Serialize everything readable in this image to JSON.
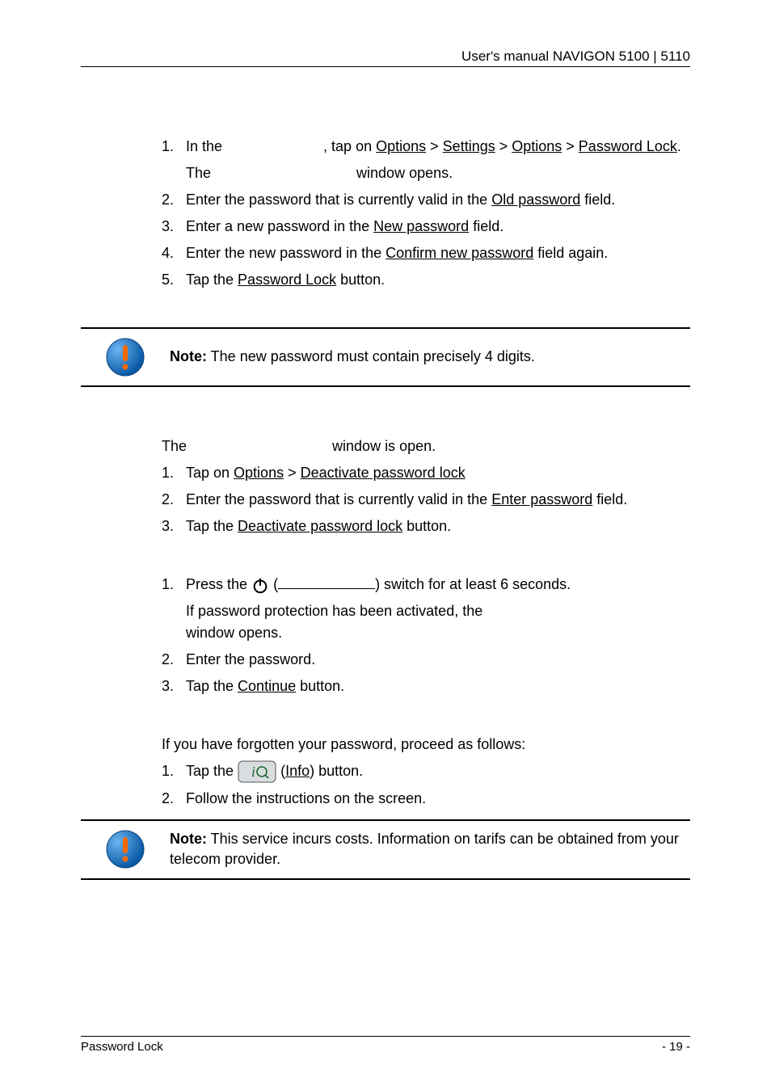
{
  "header": "User's manual NAVIGON 5100 | 5110",
  "s1": {
    "step1a": "In the ",
    "step1b": ", tap on ",
    "u1": "Options",
    "gt": " > ",
    "u2": "Settings",
    "u3": "Options",
    "u4": "Password Lock",
    "period": ".",
    "sub1a": "The ",
    "sub1b": " window opens.",
    "step2a": "Enter the password that is currently valid in the ",
    "u5": "Old password",
    "step2b": " field.",
    "step3a": "Enter a new password in the ",
    "u6": "New password",
    "step3b": " field.",
    "step4a": "Enter the new password in the ",
    "u7": "Confirm new password",
    "step4b": " field again.",
    "step5a": "Tap the ",
    "u8": "Password Lock",
    "step5b": " button."
  },
  "note1": {
    "prefix": "Note:",
    "text": " The new password must contain precisely 4 digits."
  },
  "s2": {
    "introa": "The ",
    "introb": " window is open.",
    "step1a": "Tap on ",
    "u1": "Options",
    "gt": " > ",
    "u2": "Deactivate password lock",
    "step2a": "Enter the password that is currently valid in the ",
    "u3": "Enter password",
    "step2b": " field.",
    "step3a": "Tap the ",
    "u4": "Deactivate password lock",
    "step3b": " button."
  },
  "s3": {
    "step1a": "Press the ",
    "step1b": "(",
    "step1c": ") switch for at least 6 seconds.",
    "sub1a": "If password protection has been activated, the ",
    "sub1b": " window opens.",
    "step2": "Enter the password.",
    "step3a": "Tap the ",
    "u1": "Continue",
    "step3b": " button."
  },
  "s4": {
    "intro": "If you have forgotten your password, proceed as follows:",
    "step1a": "Tap the ",
    "step1b": " (",
    "u1": "Info",
    "step1c": ") button.",
    "step2": "Follow the instructions on the screen."
  },
  "note2": {
    "prefix": "Note:",
    "text": " This service incurs costs. Information on tarifs can be obtained from your telecom provider."
  },
  "footer": {
    "left": "Password Lock",
    "right": "- 19 -"
  },
  "nums": {
    "n1": "1.",
    "n2": "2.",
    "n3": "3.",
    "n4": "4.",
    "n5": "5."
  }
}
